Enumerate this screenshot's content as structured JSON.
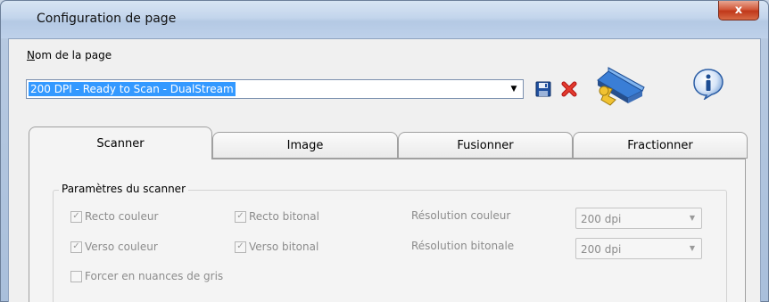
{
  "window": {
    "title": "Configuration de page",
    "close_label": "x"
  },
  "page_name": {
    "label_underlined": "N",
    "label_rest": "om de la page",
    "selected_value": "200 DPI - Ready to Scan - DualStream",
    "dropdown_arrow": "▼"
  },
  "toolbar_icons": [
    "save-icon",
    "delete-icon",
    "scanner-settings-icon",
    "info-icon"
  ],
  "tabs": [
    {
      "label": "Scanner",
      "active": true
    },
    {
      "label": "Image",
      "active": false
    },
    {
      "label": "Fusionner",
      "active": false
    },
    {
      "label": "Fractionner",
      "active": false
    }
  ],
  "scanner_params": {
    "group_title": "Paramètres du scanner",
    "recto_couleur": {
      "label": "Recto couleur",
      "checked": true,
      "enabled": false
    },
    "recto_bitonal": {
      "label": "Recto bitonal",
      "checked": true,
      "enabled": false
    },
    "verso_couleur": {
      "label": "Verso couleur",
      "checked": true,
      "enabled": false
    },
    "verso_bitonal": {
      "label": "Verso bitonal",
      "checked": true,
      "enabled": false
    },
    "forcer_gris": {
      "label": "Forcer en nuances de gris",
      "checked": false,
      "enabled": false
    },
    "resolution_couleur": {
      "label": "Résolution couleur",
      "value": "200 dpi"
    },
    "resolution_bitonale": {
      "label": "Résolution bitonale",
      "value": "200 dpi"
    },
    "check_glyph": "✓",
    "select_arrow": "▼"
  },
  "colors": {
    "selection_highlight": "#3399ff",
    "close_button": "#c0381a",
    "disabled_text": "#8c8c8c"
  }
}
